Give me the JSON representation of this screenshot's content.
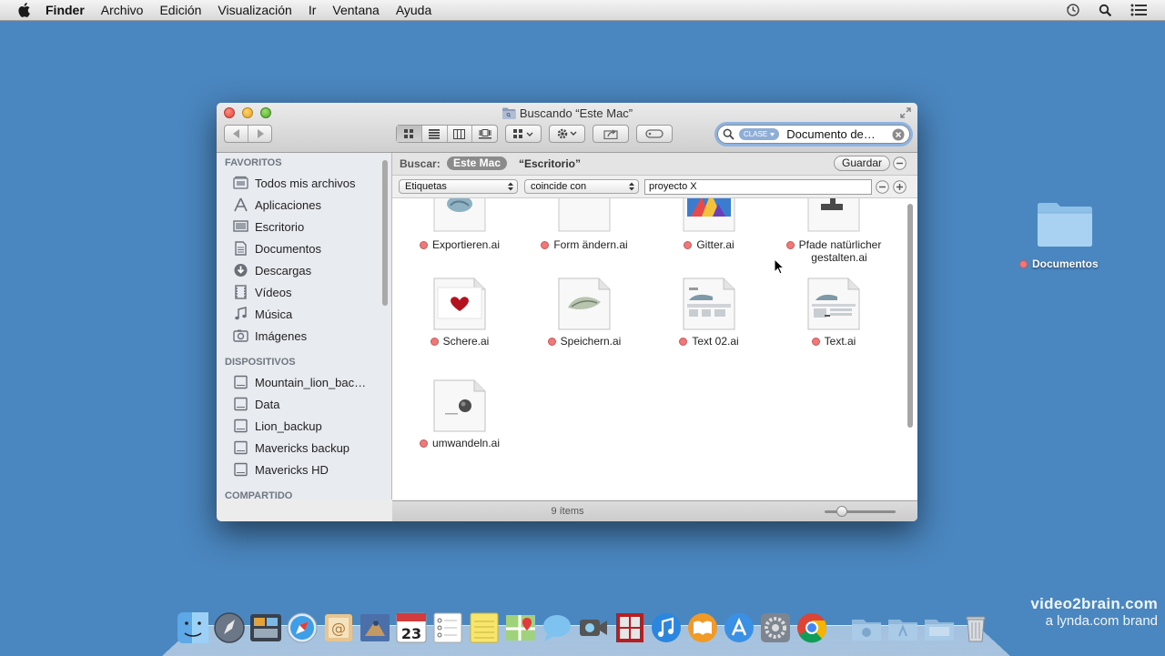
{
  "menubar": {
    "items": [
      {
        "label": "Finder",
        "bold": true
      },
      {
        "label": "Archivo"
      },
      {
        "label": "Edición"
      },
      {
        "label": "Visualización"
      },
      {
        "label": "Ir"
      },
      {
        "label": "Ventana"
      },
      {
        "label": "Ayuda"
      }
    ],
    "status_icons": [
      "time-machine-icon",
      "spotlight-icon",
      "notification-center-icon"
    ]
  },
  "window": {
    "title": "Buscando “Este Mac”",
    "search": {
      "token": "CLASE",
      "value": "Documento de…"
    },
    "scope": {
      "label": "Buscar:",
      "active": "Este Mac",
      "other": "“Escritorio”",
      "save": "Guardar"
    },
    "criteria": {
      "attribute": "Etiquetas",
      "operator": "coincide con",
      "value": "proyecto X"
    },
    "sidebar": {
      "favorites_title": "FAVORITOS",
      "favorites": [
        {
          "label": "Todos mis archivos",
          "icon": "all-files-icon"
        },
        {
          "label": "Aplicaciones",
          "icon": "applications-icon"
        },
        {
          "label": "Escritorio",
          "icon": "desktop-icon"
        },
        {
          "label": "Documentos",
          "icon": "documents-icon"
        },
        {
          "label": "Descargas",
          "icon": "downloads-icon"
        },
        {
          "label": "Vídeos",
          "icon": "movies-icon"
        },
        {
          "label": "Música",
          "icon": "music-icon"
        },
        {
          "label": "Imágenes",
          "icon": "pictures-icon"
        }
      ],
      "devices_title": "DISPOSITIVOS",
      "devices": [
        {
          "label": "Mountain_lion_bac…",
          "icon": "drive-icon"
        },
        {
          "label": "Data",
          "icon": "drive-icon"
        },
        {
          "label": "Lion_backup",
          "icon": "drive-icon"
        },
        {
          "label": "Mavericks backup",
          "icon": "drive-icon"
        },
        {
          "label": "Mavericks HD",
          "icon": "drive-icon"
        }
      ],
      "shared_title": "COMPARTIDO"
    },
    "files": [
      {
        "name": "Exportieren.ai",
        "tag_color": "#f07878"
      },
      {
        "name": "Form ändern.ai",
        "tag_color": "#f07878"
      },
      {
        "name": "Gitter.ai",
        "tag_color": "#f07878"
      },
      {
        "name": "Pfade natürlicher",
        "name2": "gestalten.ai",
        "tag_color": "#f07878"
      },
      {
        "name": "Schere.ai",
        "tag_color": "#f07878"
      },
      {
        "name": "Speichern.ai",
        "tag_color": "#f07878"
      },
      {
        "name": "Text 02.ai",
        "tag_color": "#f07878"
      },
      {
        "name": "Text.ai",
        "tag_color": "#f07878"
      },
      {
        "name": "umwandeln.ai",
        "tag_color": "#f07878"
      }
    ],
    "status": "9 ítems"
  },
  "desktop": {
    "folder_label": "Documentos",
    "tag_color": "#f07878"
  },
  "watermark": {
    "line1": "video2brain.com",
    "line2": "a lynda.com brand"
  },
  "dock": {
    "icons": [
      "finder-icon",
      "launchpad-icon",
      "mission-control-icon",
      "safari-icon",
      "mail-icon",
      "contacts-icon",
      "calendar-icon",
      "reminders-icon",
      "notes-icon",
      "maps-icon",
      "messages-icon",
      "facetime-icon",
      "photo-booth-icon",
      "itunes-icon",
      "ibooks-icon",
      "app-store-icon",
      "system-preferences-icon",
      "chrome-icon",
      "applications-folder-icon",
      "documents-folder-icon",
      "downloads-folder-icon",
      "trash-icon"
    ]
  },
  "colors": {
    "desktop": "#4a86bf",
    "tag_red": "#f07878",
    "search_focus": "#8fb3e0"
  }
}
